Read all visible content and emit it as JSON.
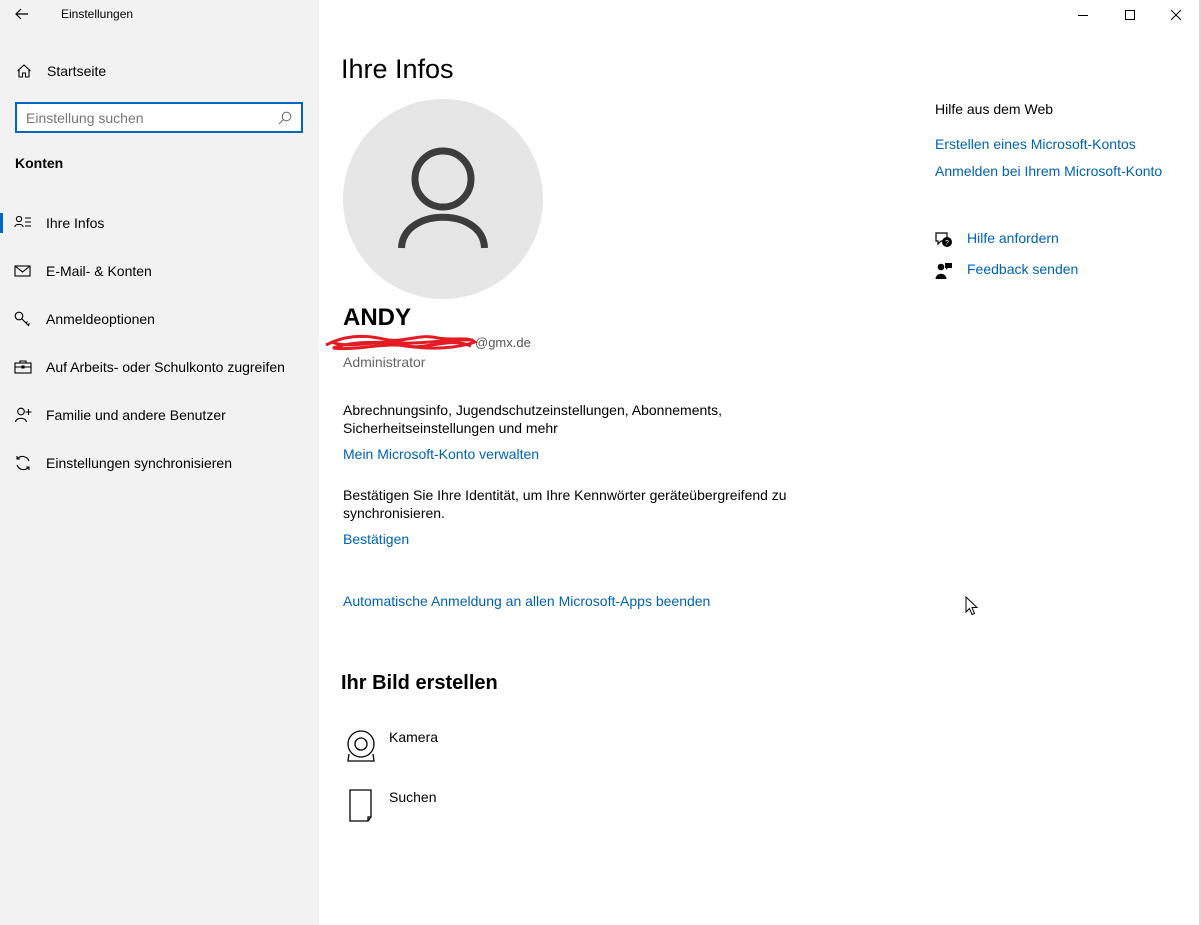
{
  "window": {
    "title": "Einstellungen",
    "back_icon": "back-arrow-icon",
    "controls": [
      "minimize-icon",
      "maximize-icon",
      "close-icon"
    ]
  },
  "sidebar": {
    "home_label": "Startseite",
    "search_placeholder": "Einstellung suchen",
    "section_label": "Konten",
    "items": [
      {
        "label": "Ihre Infos",
        "icon": "contact-info-icon",
        "active": true
      },
      {
        "label": "E-Mail- & Konten",
        "icon": "mail-icon",
        "active": false
      },
      {
        "label": "Anmeldeoptionen",
        "icon": "key-icon",
        "active": false
      },
      {
        "label": "Auf Arbeits- oder Schulkonto zugreifen",
        "icon": "briefcase-icon",
        "active": false
      },
      {
        "label": "Familie und andere Benutzer",
        "icon": "add-user-icon",
        "active": false
      },
      {
        "label": "Einstellungen synchronisieren",
        "icon": "sync-icon",
        "active": false
      }
    ]
  },
  "main": {
    "title": "Ihre Infos",
    "user": {
      "name": "ANDY",
      "email_visible": "@gmx.de",
      "role": "Administrator"
    },
    "billing_desc": "Abrechnungsinfo, Jugendschutzeinstellungen, Abonnements, Sicherheitseinstellungen und mehr",
    "manage_link": "Mein Microsoft-Konto verwalten",
    "verify_desc": "Bestätigen Sie Ihre Identität, um Ihre Kennwörter geräteübergreifend zu synchronisieren.",
    "verify_link": "Bestätigen",
    "auto_signin_link": "Automatische Anmeldung an allen Microsoft-Apps beenden",
    "picture_heading": "Ihr Bild erstellen",
    "picture_options": [
      {
        "label": "Kamera",
        "icon": "webcam-icon"
      },
      {
        "label": "Suchen",
        "icon": "file-icon"
      }
    ]
  },
  "help": {
    "title": "Hilfe aus dem Web",
    "web_links": [
      "Erstellen eines Microsoft-Kontos",
      "Anmelden bei Ihrem Microsoft-Konto"
    ],
    "get_help": "Hilfe anfordern",
    "feedback": "Feedback senden"
  },
  "colors": {
    "accent": "#0067c0",
    "link": "#0063b1",
    "sidebar_bg": "#f2f2f2",
    "avatar_bg": "#e6e6e6"
  }
}
